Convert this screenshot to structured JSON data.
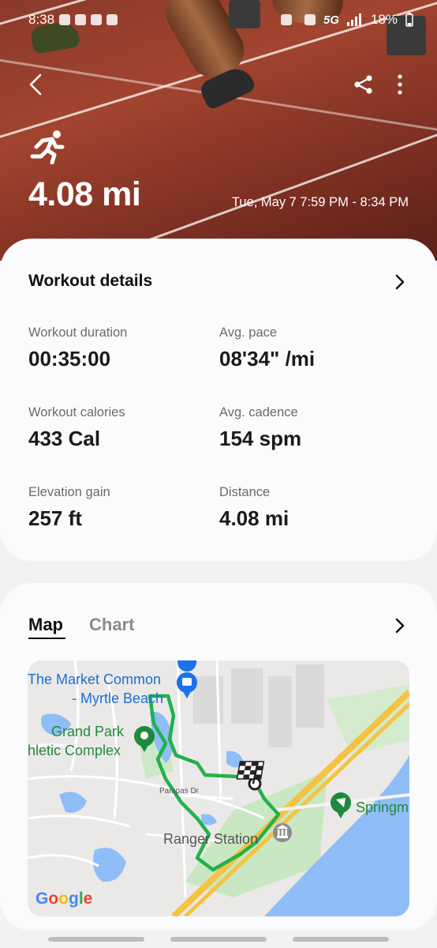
{
  "status_bar": {
    "time": "8:38",
    "network": "5G",
    "battery": "18%"
  },
  "header": {
    "icons": [
      "back-arrow-icon",
      "share-icon",
      "more-options-icon",
      "running-icon"
    ],
    "distance": "4.08 mi",
    "time_range": "Tue, May 7 7:59 PM - 8:34 PM"
  },
  "workout_details": {
    "title": "Workout details",
    "stats": [
      {
        "label": "Workout duration",
        "value": "00:35:00"
      },
      {
        "label": "Avg. pace",
        "value": "08'34\" /mi"
      },
      {
        "label": "Workout calories",
        "value": "433 Cal"
      },
      {
        "label": "Avg. cadence",
        "value": "154 spm"
      },
      {
        "label": "Elevation gain",
        "value": "257 ft"
      },
      {
        "label": "Distance",
        "value": "4.08 mi"
      }
    ]
  },
  "map_section": {
    "tabs": [
      {
        "label": "Map",
        "active": true
      },
      {
        "label": "Chart",
        "active": false
      }
    ],
    "map": {
      "labels": {
        "market_line1": "The Market Common",
        "market_line2": "- Myrtle Beach",
        "park_line1": "Grand Park",
        "park_line2": "hletic Complex",
        "street": "Pampas Dr",
        "ranger": "Ranger Station",
        "springmaid": "Springm"
      },
      "attribution": "Google"
    }
  },
  "colors": {
    "accent": "#1a73e8",
    "route": "#22b14c",
    "water": "#8fbdf7",
    "highway": "#f5c242",
    "park": "#c7e6c1",
    "map_label_blue": "#1a6fd1",
    "map_label_green": "#1e8a3c"
  }
}
